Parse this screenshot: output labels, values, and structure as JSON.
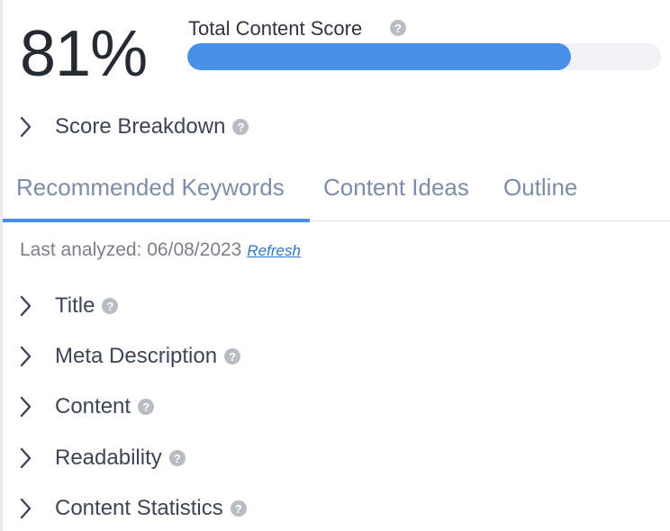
{
  "score": {
    "value": "81%",
    "label": "Total Content Score",
    "progress_percent": 81
  },
  "breakdown": {
    "label": "Score Breakdown"
  },
  "tabs": [
    {
      "label": "Recommended Keywords",
      "active": true
    },
    {
      "label": "Content Ideas",
      "active": false
    },
    {
      "label": "Outline",
      "active": false
    }
  ],
  "analysis": {
    "last_analyzed": "Last analyzed: 06/08/2023",
    "refresh_label": "Refresh"
  },
  "sections": [
    {
      "label": "Title"
    },
    {
      "label": "Meta Description"
    },
    {
      "label": "Content"
    },
    {
      "label": "Readability"
    },
    {
      "label": "Content Statistics"
    }
  ],
  "icons": {
    "help": "question-circle-icon",
    "expand": "chevron-right-icon"
  },
  "colors": {
    "accent": "#4a90e8",
    "progress_track": "#f1f2f4",
    "tab_text": "#7d8da8",
    "help_icon": "#b8bcc3",
    "link": "#2f78c9"
  }
}
